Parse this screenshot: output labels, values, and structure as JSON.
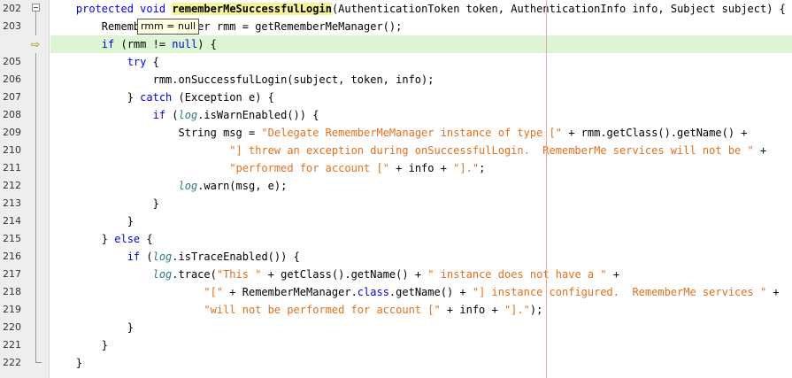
{
  "tooltip": {
    "text": "rmm = null"
  },
  "colors": {
    "keyword": "#0000e6",
    "string": "#e0701e",
    "field": "#2a7a8a",
    "current_line": "#dcf5d2",
    "highlight": "#f7f39a",
    "margin_line": "#f2a0a0"
  },
  "lines": [
    {
      "num": "202",
      "gutter": "fold-start",
      "current": false,
      "segments": [
        {
          "t": "    "
        },
        {
          "t": "protected",
          "k": "kw"
        },
        {
          "t": " "
        },
        {
          "t": "void",
          "k": "kw"
        },
        {
          "t": " "
        },
        {
          "t": "rememberMeSuccessfulLogin",
          "k": "hl"
        },
        {
          "t": "(AuthenticationToken token, AuthenticationInfo info, Subject subject) {"
        }
      ]
    },
    {
      "num": "203",
      "gutter": "fold-line",
      "current": false,
      "segments": [
        {
          "t": "        RememberMeManager rmm = getRememberMeManager();"
        }
      ]
    },
    {
      "num": "",
      "gutter": "arrow-icon",
      "current": true,
      "segments": [
        {
          "t": "        "
        },
        {
          "t": "if",
          "k": "kw"
        },
        {
          "t": " (rmm != "
        },
        {
          "t": "null",
          "k": "kw"
        },
        {
          "t": ") {"
        }
      ]
    },
    {
      "num": "205",
      "gutter": "fold-line",
      "current": false,
      "segments": [
        {
          "t": "            "
        },
        {
          "t": "try",
          "k": "kw"
        },
        {
          "t": " {"
        }
      ]
    },
    {
      "num": "206",
      "gutter": "fold-line",
      "current": false,
      "segments": [
        {
          "t": "                rmm.onSuccessfulLogin(subject, token, info);"
        }
      ]
    },
    {
      "num": "207",
      "gutter": "fold-line",
      "current": false,
      "segments": [
        {
          "t": "            } "
        },
        {
          "t": "catch",
          "k": "kw"
        },
        {
          "t": " (Exception e) {"
        }
      ]
    },
    {
      "num": "208",
      "gutter": "fold-line",
      "current": false,
      "segments": [
        {
          "t": "                "
        },
        {
          "t": "if",
          "k": "kw"
        },
        {
          "t": " ("
        },
        {
          "t": "log",
          "k": "fd"
        },
        {
          "t": ".isWarnEnabled()) {"
        }
      ]
    },
    {
      "num": "209",
      "gutter": "fold-line",
      "current": false,
      "segments": [
        {
          "t": "                    String msg = "
        },
        {
          "t": "\"Delegate RememberMeManager instance of type [\"",
          "k": "st"
        },
        {
          "t": " + rmm.getClass().getName() +"
        }
      ]
    },
    {
      "num": "210",
      "gutter": "fold-line",
      "current": false,
      "segments": [
        {
          "t": "                            "
        },
        {
          "t": "\"] threw an exception during onSuccessfulLogin.  RememberMe services will not be \"",
          "k": "st"
        },
        {
          "t": " +"
        }
      ]
    },
    {
      "num": "211",
      "gutter": "fold-line",
      "current": false,
      "segments": [
        {
          "t": "                            "
        },
        {
          "t": "\"performed for account [\"",
          "k": "st"
        },
        {
          "t": " + info + "
        },
        {
          "t": "\"].\"",
          "k": "st"
        },
        {
          "t": ";"
        }
      ]
    },
    {
      "num": "212",
      "gutter": "fold-line",
      "current": false,
      "segments": [
        {
          "t": "                    "
        },
        {
          "t": "log",
          "k": "fd"
        },
        {
          "t": ".warn(msg, e);"
        }
      ]
    },
    {
      "num": "213",
      "gutter": "fold-line",
      "current": false,
      "segments": [
        {
          "t": "                }"
        }
      ]
    },
    {
      "num": "214",
      "gutter": "fold-line",
      "current": false,
      "segments": [
        {
          "t": "            }"
        }
      ]
    },
    {
      "num": "215",
      "gutter": "fold-line",
      "current": false,
      "segments": [
        {
          "t": "        } "
        },
        {
          "t": "else",
          "k": "kw"
        },
        {
          "t": " {"
        }
      ]
    },
    {
      "num": "216",
      "gutter": "fold-line",
      "current": false,
      "segments": [
        {
          "t": "            "
        },
        {
          "t": "if",
          "k": "kw"
        },
        {
          "t": " ("
        },
        {
          "t": "log",
          "k": "fd"
        },
        {
          "t": ".isTraceEnabled()) {"
        }
      ]
    },
    {
      "num": "217",
      "gutter": "fold-line",
      "current": false,
      "segments": [
        {
          "t": "                "
        },
        {
          "t": "log",
          "k": "fd"
        },
        {
          "t": ".trace("
        },
        {
          "t": "\"This \"",
          "k": "st"
        },
        {
          "t": " + getClass().getName() + "
        },
        {
          "t": "\" instance does not have a \"",
          "k": "st"
        },
        {
          "t": " +"
        }
      ]
    },
    {
      "num": "218",
      "gutter": "fold-line",
      "current": false,
      "segments": [
        {
          "t": "                        "
        },
        {
          "t": "\"[\"",
          "k": "st"
        },
        {
          "t": " + RememberMeManager."
        },
        {
          "t": "class",
          "k": "kw"
        },
        {
          "t": ".getName() + "
        },
        {
          "t": "\"] instance configured.  RememberMe services \"",
          "k": "st"
        },
        {
          "t": " +"
        }
      ]
    },
    {
      "num": "219",
      "gutter": "fold-line",
      "current": false,
      "segments": [
        {
          "t": "                        "
        },
        {
          "t": "\"will not be performed for account [\"",
          "k": "st"
        },
        {
          "t": " + info + "
        },
        {
          "t": "\"].\"",
          "k": "st"
        },
        {
          "t": ");"
        }
      ]
    },
    {
      "num": "220",
      "gutter": "fold-line",
      "current": false,
      "segments": [
        {
          "t": "            }"
        }
      ]
    },
    {
      "num": "221",
      "gutter": "fold-line",
      "current": false,
      "segments": [
        {
          "t": "        }"
        }
      ]
    },
    {
      "num": "222",
      "gutter": "fold-end",
      "current": false,
      "segments": [
        {
          "t": "    }"
        }
      ]
    }
  ]
}
